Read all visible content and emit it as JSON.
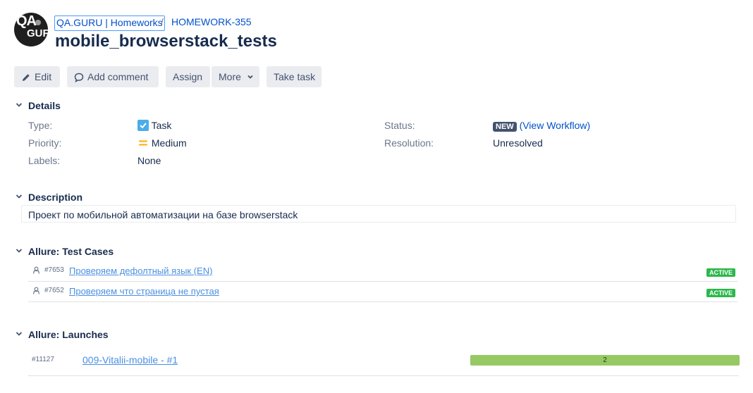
{
  "header": {
    "logo_text_top": "QA",
    "logo_text_bottom": "GURU",
    "project_name": "QA.GURU | Homeworks",
    "separator": "/",
    "issue_key": "HOMEWORK-355",
    "title": "mobile_browserstack_tests"
  },
  "toolbar": {
    "edit": "Edit",
    "add_comment": "Add comment",
    "assign": "Assign",
    "more": "More",
    "take_task": "Take task"
  },
  "details": {
    "heading": "Details",
    "type_label": "Type:",
    "type_value": "Task",
    "priority_label": "Priority:",
    "priority_value": "Medium",
    "labels_label": "Labels:",
    "labels_value": "None",
    "status_label": "Status:",
    "status_badge": "NEW",
    "view_workflow": "(View Workflow)",
    "resolution_label": "Resolution:",
    "resolution_value": "Unresolved"
  },
  "description": {
    "heading": "Description",
    "text": "Проект по мобильной автоматизации на базе browserstack"
  },
  "test_cases": {
    "heading": "Allure: Test Cases",
    "items": [
      {
        "id": "#7653",
        "name": "Проверяем дефолтный язык (EN)",
        "status": "ACTIVE"
      },
      {
        "id": "#7652",
        "name": "Проверяем что страница не пустая",
        "status": "ACTIVE"
      }
    ]
  },
  "launches": {
    "heading": "Allure: Launches",
    "items": [
      {
        "id": "#11127",
        "name": "009-Vitalii-mobile - #1",
        "passed_count": "2",
        "passed_fraction": 1.0
      }
    ]
  },
  "colors": {
    "link": "#0052cc",
    "active_badge": "#2db84c",
    "status_badge": "#42526e",
    "progress_passed": "#96c964",
    "priority_medium": "#ffab00",
    "task_icon": "#4bade8"
  }
}
